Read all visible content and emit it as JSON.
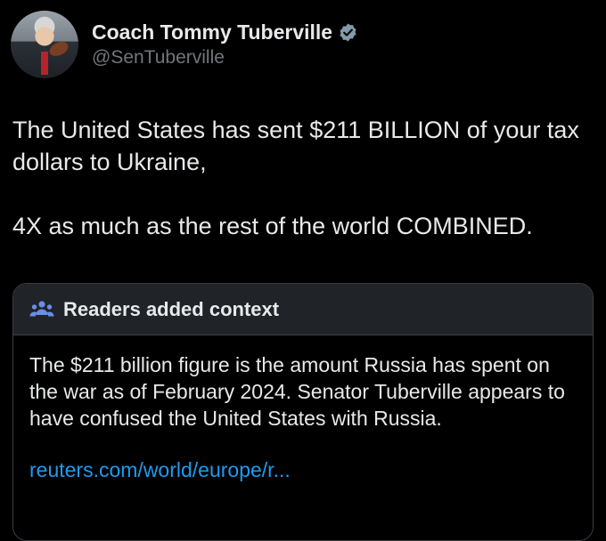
{
  "author": {
    "display_name": "Coach Tommy Tuberville",
    "handle": "@SenTuberville"
  },
  "tweet": {
    "paragraphs": [
      "The United States has sent $211 BILLION of your tax dollars to Ukraine,",
      "4X as much as the rest of the world COMBINED."
    ]
  },
  "context": {
    "title": "Readers added context",
    "text": "The $211 billion figure is the amount Russia has spent on the war as of February 2024. Senator Tuberville appears to have confused the United States with Russia.",
    "link": "reuters.com/world/europe/r..."
  },
  "icons": {
    "verified": "verified-badge-icon",
    "context": "people-icon"
  },
  "colors": {
    "background": "#000000",
    "link": "#1d9bf0",
    "context_accent": "#6a8de8"
  }
}
